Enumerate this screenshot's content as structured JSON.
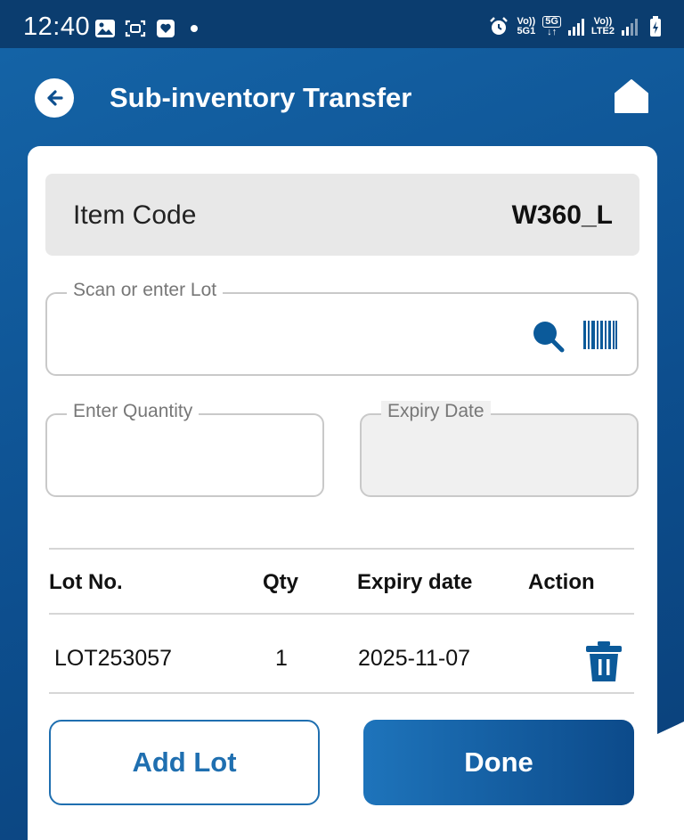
{
  "status_bar": {
    "time": "12:40",
    "left_icons": [
      "gallery-icon",
      "screenshot-icon",
      "health-icon",
      "notification-dot"
    ],
    "net1_top": "Vo))",
    "net1_bottom": "5G1",
    "net_5g_badge": "5G",
    "net2_top": "Vo))",
    "net2_bottom": "LTE2"
  },
  "header": {
    "title": "Sub-inventory Transfer",
    "back_icon": "back-arrow-icon",
    "home_icon": "home-icon"
  },
  "item_code": {
    "label": "Item Code",
    "value": "W360_L"
  },
  "form": {
    "lot": {
      "label": "Scan or enter Lot",
      "value": ""
    },
    "quantity": {
      "label": "Enter Quantity",
      "value": ""
    },
    "expiry": {
      "label": "Expiry Date",
      "value": ""
    }
  },
  "table": {
    "headers": [
      "Lot No.",
      "Qty",
      "Expiry date",
      "Action"
    ],
    "rows": [
      {
        "lot": "LOT253057",
        "qty": "1",
        "expiry": "2025-11-07",
        "action_icon": "trash-icon"
      }
    ]
  },
  "buttons": {
    "add_lot": "Add Lot",
    "done": "Done"
  },
  "colors": {
    "primary": "#0d4f8f",
    "accent": "#1f6fb0",
    "icon_blue": "#0b5a9a"
  }
}
